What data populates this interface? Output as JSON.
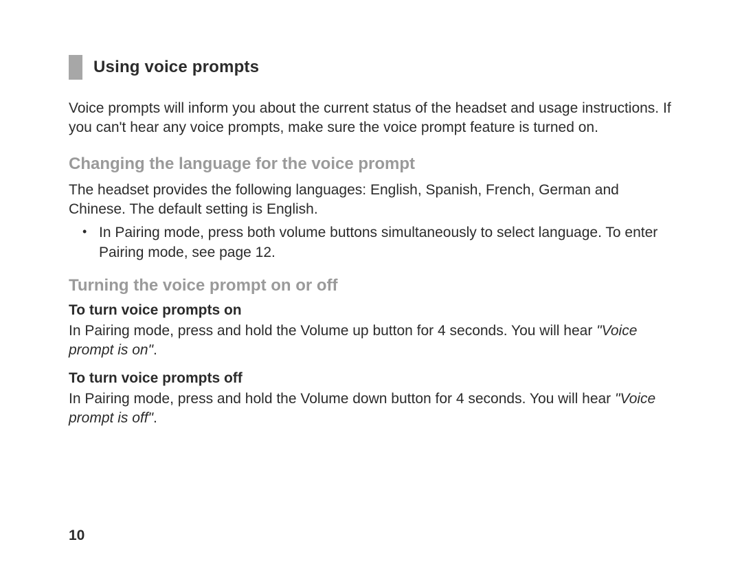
{
  "page_number": "10",
  "heading": "Using voice prompts",
  "intro": "Voice prompts will inform you about the current status of the headset and usage instructions. If you can't hear any voice prompts, make sure the voice prompt feature is turned on.",
  "section_language": {
    "title": "Changing the language for the voice prompt",
    "desc": "The headset provides the following languages: English, Spanish, French, German and Chinese. The default setting is English.",
    "bullet": "In Pairing mode, press both volume buttons simultaneously to select language. To enter Pairing mode, see page 12."
  },
  "section_toggle": {
    "title": "Turning the voice prompt on or off",
    "on": {
      "label": "To turn voice prompts on",
      "body_pre": "In Pairing mode, press and hold the Volume up button for 4 seconds. You will hear ",
      "quote": "\"Voice prompt is on\"",
      "body_post": "."
    },
    "off": {
      "label": "To turn voice prompts off",
      "body_pre": "In Pairing mode, press and hold the Volume down button for 4 seconds. You will hear ",
      "quote": "\"Voice prompt is off\"",
      "body_post": "."
    }
  }
}
